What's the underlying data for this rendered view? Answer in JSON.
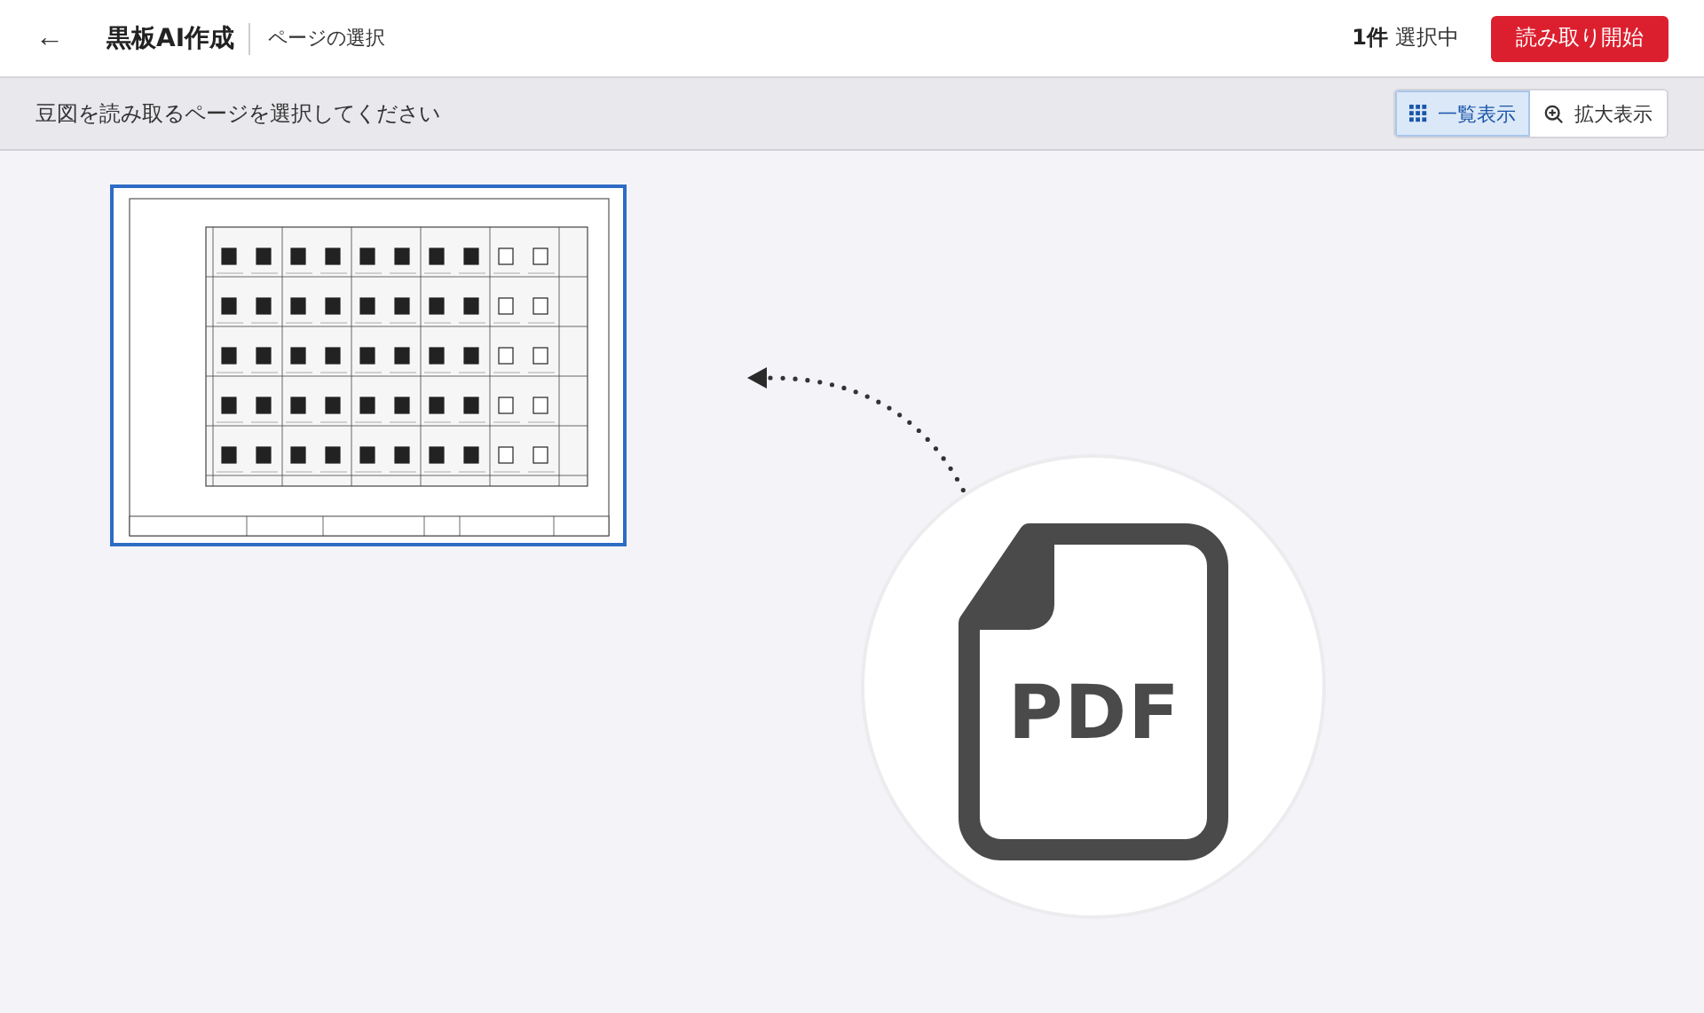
{
  "header": {
    "back": "←",
    "title": "黒板AI作成",
    "subtitle": "ページの選択",
    "count": "1件",
    "count_label": "選択中",
    "primary_button": "読み取り開始"
  },
  "toolbar": {
    "instruction": "豆図を読み取るページを選択してください",
    "views": [
      {
        "kind": "grid",
        "label": "一覧表示",
        "selected": true
      },
      {
        "kind": "zoom",
        "label": "拡大表示",
        "selected": false
      }
    ]
  },
  "pages": [
    {
      "kind": "picture",
      "selected": true
    }
  ],
  "illustration": {
    "file_type": "PDF"
  }
}
